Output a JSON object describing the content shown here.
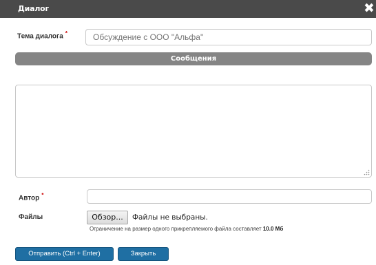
{
  "dialog": {
    "title": "Диалог",
    "close_glyph": "✖"
  },
  "form": {
    "subject": {
      "label": "Тема диалога",
      "required_mark": "*",
      "value": "",
      "placeholder": "Обсуждение с ООО \"Альфа\""
    },
    "messages_section": {
      "label": "Сообщения"
    },
    "message_text": {
      "value": ""
    },
    "author": {
      "label": "Автор",
      "required_mark": "*",
      "value": ""
    },
    "files": {
      "label": "Файлы",
      "browse_label": "Обзор...",
      "status_text": "Файлы не выбраны.",
      "limit_prefix": "Ограничение на размер одного прикрепляемого файла составляет",
      "limit_value": "10.0 Мб"
    }
  },
  "actions": {
    "send_label": "Отправить (Ctrl + Enter)",
    "close_label": "Закрыть"
  },
  "colors": {
    "titlebar": "#4a4a4a",
    "section_bar": "#858585",
    "primary_button": "#1f6fa3",
    "required": "#cc0000"
  }
}
